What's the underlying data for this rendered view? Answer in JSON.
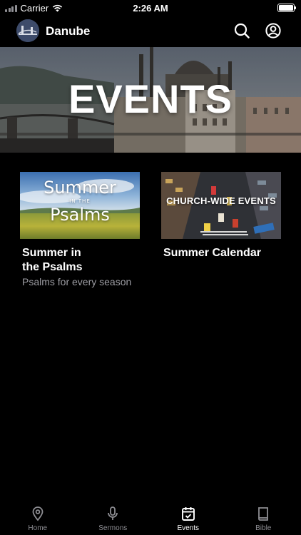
{
  "status_bar": {
    "carrier": "Carrier",
    "time": "2:26 AM"
  },
  "header": {
    "app_name": "Danube",
    "logo_icon": "bridge-logo-icon",
    "search_icon": "search-icon",
    "account_icon": "account-icon"
  },
  "hero": {
    "title": "EVENTS"
  },
  "events": [
    {
      "title": "Summer in the Psalms",
      "subtitle": "Psalms for every season",
      "thumbnail": {
        "line1": "Summer",
        "line2": "IN THE",
        "line3": "Psalms"
      }
    },
    {
      "title": "Summer Calendar",
      "subtitle": "",
      "thumbnail": {
        "line1": "CHURCH-WIDE EVENTS"
      }
    }
  ],
  "tab_bar": {
    "tabs": [
      {
        "label": "Home",
        "icon": "location-pin-icon",
        "active": false
      },
      {
        "label": "Sermons",
        "icon": "microphone-icon",
        "active": false
      },
      {
        "label": "Events",
        "icon": "calendar-icon",
        "active": true
      },
      {
        "label": "Bible",
        "icon": "book-icon",
        "active": false
      }
    ]
  },
  "colors": {
    "background": "#000000",
    "text_primary": "#ffffff",
    "text_secondary": "#9d9da3",
    "tab_inactive": "#8e8e93"
  }
}
